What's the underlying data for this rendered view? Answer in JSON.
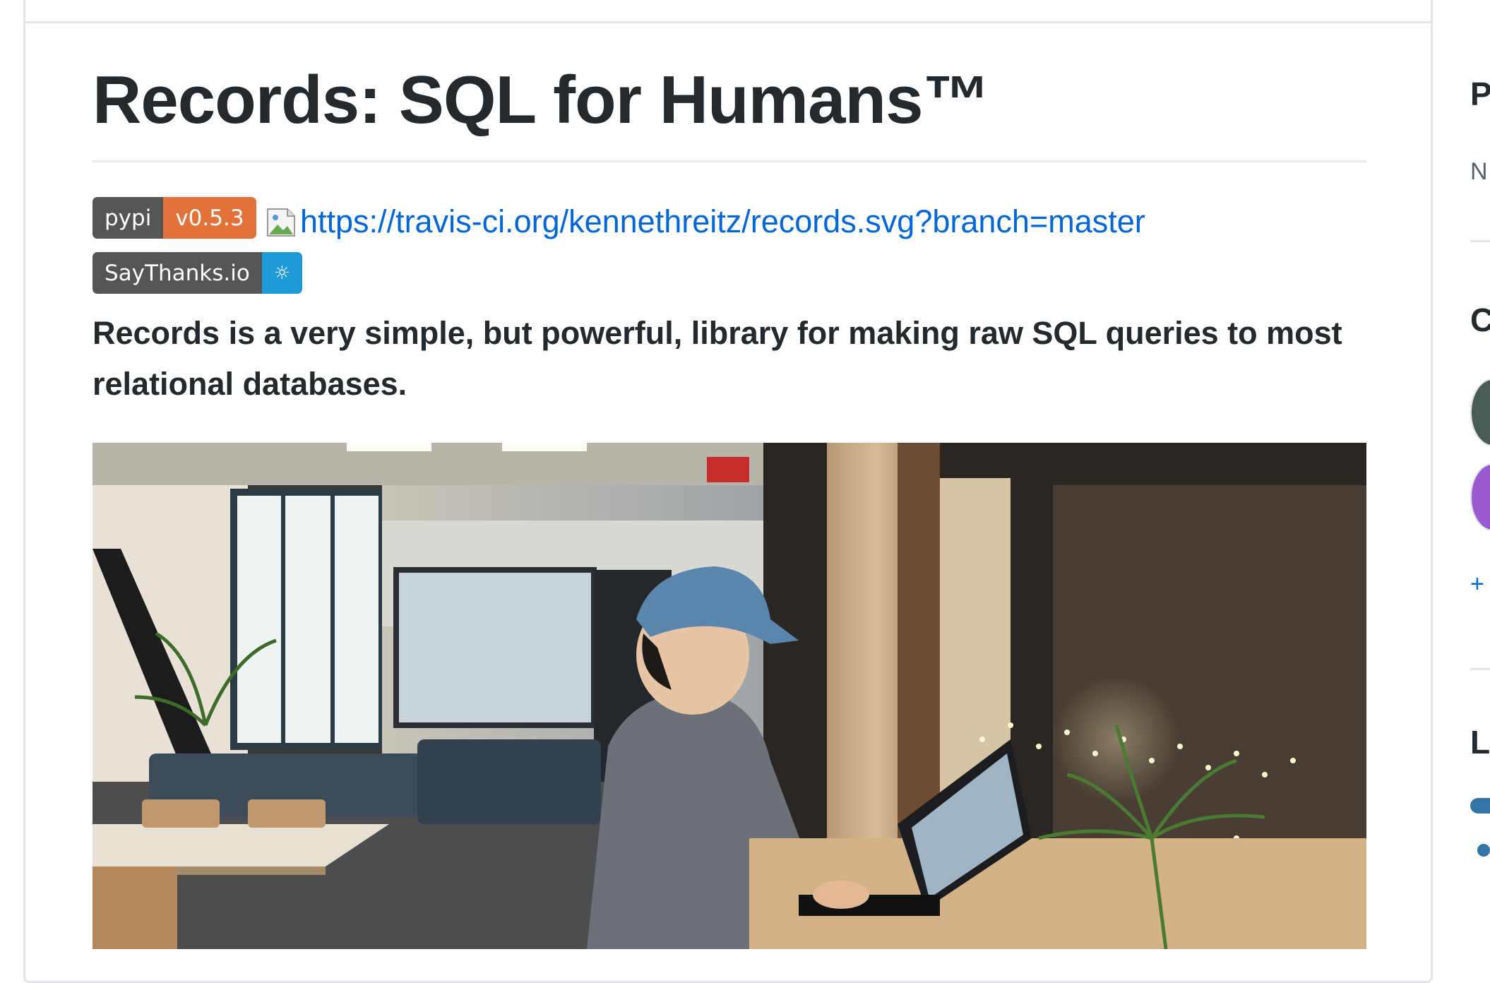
{
  "readme": {
    "title": "Records: SQL for Humans™",
    "badges": [
      {
        "name": "pypi",
        "left": "pypi",
        "right": "v0.5.3",
        "right_color": "#e0723a"
      },
      {
        "name": "saythanks",
        "left": "SayThanks.io",
        "right": "☼",
        "right_color": "#1e9bd7"
      }
    ],
    "travis_badge_alt": "https://travis-ci.org/kennethreitz/records.svg?branch=master",
    "description": "Records is a very simple, but powerful, library for making raw SQL queries to most relational databases."
  },
  "sidebar": {
    "heading_1": "P",
    "text_1": "N",
    "heading_2": "C",
    "more_link": "+",
    "heading_3": "L"
  },
  "colors": {
    "link": "#0366d6",
    "text": "#24292e",
    "border": "#e1e4e8",
    "language_bar": "#3572a5"
  }
}
